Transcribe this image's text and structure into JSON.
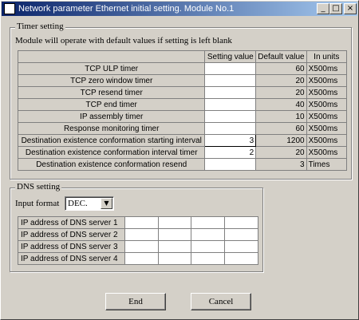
{
  "window": {
    "title": "Network parameter Ethernet initial setting. Module No.1",
    "minimize_glyph": "_",
    "maximize_glyph": "□",
    "close_glyph": "×"
  },
  "timer": {
    "group_label": "Timer setting",
    "description": "Module will operate with default values if setting is left blank",
    "headers": [
      "",
      "Setting value",
      "Default value",
      "In units"
    ],
    "rows": [
      {
        "label": "TCP ULP timer",
        "value": "",
        "default": "60",
        "unit": "X500ms"
      },
      {
        "label": "TCP zero window timer",
        "value": "",
        "default": "20",
        "unit": "X500ms"
      },
      {
        "label": "TCP resend timer",
        "value": "",
        "default": "20",
        "unit": "X500ms"
      },
      {
        "label": "TCP end timer",
        "value": "",
        "default": "40",
        "unit": "X500ms"
      },
      {
        "label": "IP assembly timer",
        "value": "",
        "default": "10",
        "unit": "X500ms"
      },
      {
        "label": "Response monitoring timer",
        "value": "",
        "default": "60",
        "unit": "X500ms"
      },
      {
        "label": "Destination existence conformation starting interval",
        "value": "3",
        "default": "1200",
        "unit": "X500ms"
      },
      {
        "label": "Destination existence conformation interval timer",
        "value": "2",
        "default": "20",
        "unit": "X500ms"
      },
      {
        "label": "Destination existence conformation resend",
        "value": "",
        "default": "3",
        "unit": "Times"
      }
    ]
  },
  "dns": {
    "group_label": "DNS setting",
    "input_format_label": "Input format",
    "input_format_value": "DEC.",
    "rows": [
      {
        "label": "IP address of DNS server 1",
        "cells": [
          "",
          "",
          "",
          ""
        ]
      },
      {
        "label": "IP address of DNS server 2",
        "cells": [
          "",
          "",
          "",
          ""
        ]
      },
      {
        "label": "IP address of DNS server 3",
        "cells": [
          "",
          "",
          "",
          ""
        ]
      },
      {
        "label": "IP address of DNS server 4",
        "cells": [
          "",
          "",
          "",
          ""
        ]
      }
    ]
  },
  "buttons": {
    "end": "End",
    "cancel": "Cancel"
  }
}
